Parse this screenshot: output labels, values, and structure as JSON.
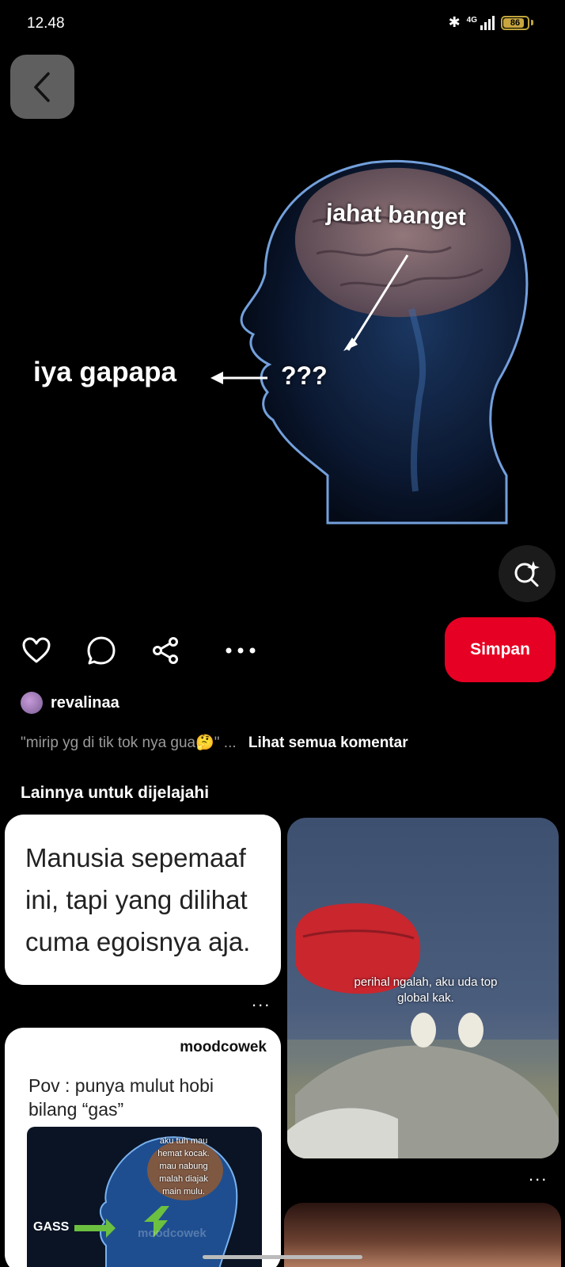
{
  "status_bar": {
    "time": "12.48",
    "network": "4G",
    "battery": "86",
    "battery_level": 0.86
  },
  "hero": {
    "label_left": "iya gapapa",
    "label_top": "jahat banget",
    "label_mid": "???"
  },
  "author": {
    "name": "revalinaa"
  },
  "comment": {
    "text": "\"mirip yg di tik tok nya gua🤔\" ...",
    "link": "Lihat semua komentar"
  },
  "actions": {
    "save_label": "Simpan"
  },
  "explore": {
    "title": "Lainnya untuk dijelajahi",
    "more": "...",
    "cards": [
      {
        "type": "quote",
        "text": "Manusia sepemaaf ini, tapi yang dilihat cuma egoisnya aja."
      },
      {
        "type": "photo",
        "caption": "perihal ngalah, aku uda top global kak."
      },
      {
        "type": "pov",
        "author": "moodcowek",
        "text": "Pov : punya mulut hobi bilang “gas”",
        "thumb_left": "GASS",
        "thumb_brain": "aku tuh mau hemat kocak. mau nabung malah diajak main mulu.",
        "thumb_watermark": "moodcowek"
      }
    ]
  }
}
